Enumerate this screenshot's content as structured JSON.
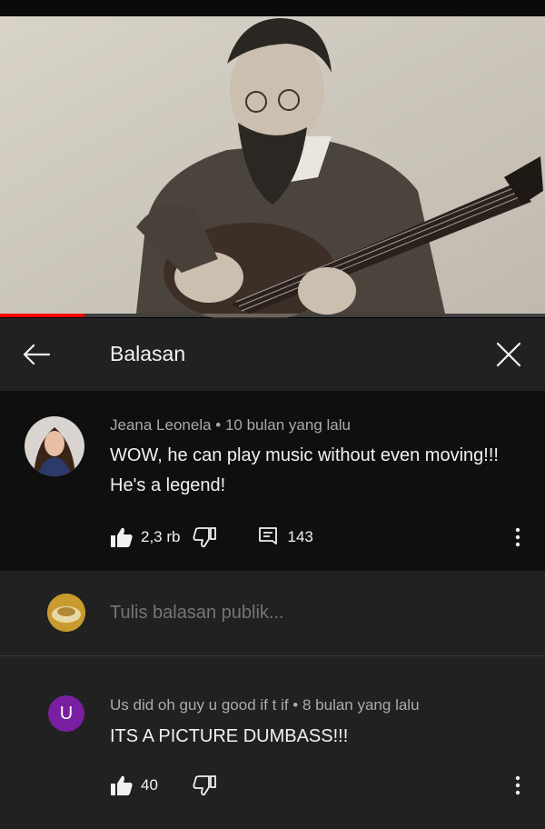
{
  "video": {
    "progress_fraction": 0.155,
    "accent_color": "#ff0000"
  },
  "header": {
    "back_icon": "arrow-left-icon",
    "title": "Balasan",
    "close_icon": "close-icon"
  },
  "main_comment": {
    "author": "Jeana Leonela",
    "separator": "•",
    "time": "10 bulan yang lalu",
    "text": "WOW, he can play music without even moving!!! He's a legend!",
    "likes": "2,3 rb",
    "replies": "143",
    "like_icon": "thumbs-up-filled-icon",
    "dislike_icon": "thumbs-down-icon",
    "reply_icon": "reply-icon",
    "more_icon": "more-vert-icon"
  },
  "reply_box": {
    "placeholder": "Tulis balasan publik..."
  },
  "reply": {
    "avatar_letter": "U",
    "avatar_color": "#7b1fa2",
    "author": "Us did oh guy u good if t if",
    "separator": "•",
    "time": "8 bulan yang lalu",
    "text": "ITS A PICTURE DUMBASS!!!",
    "likes": "40",
    "like_icon": "thumbs-up-filled-icon",
    "dislike_icon": "thumbs-down-icon",
    "more_icon": "more-vert-icon"
  }
}
